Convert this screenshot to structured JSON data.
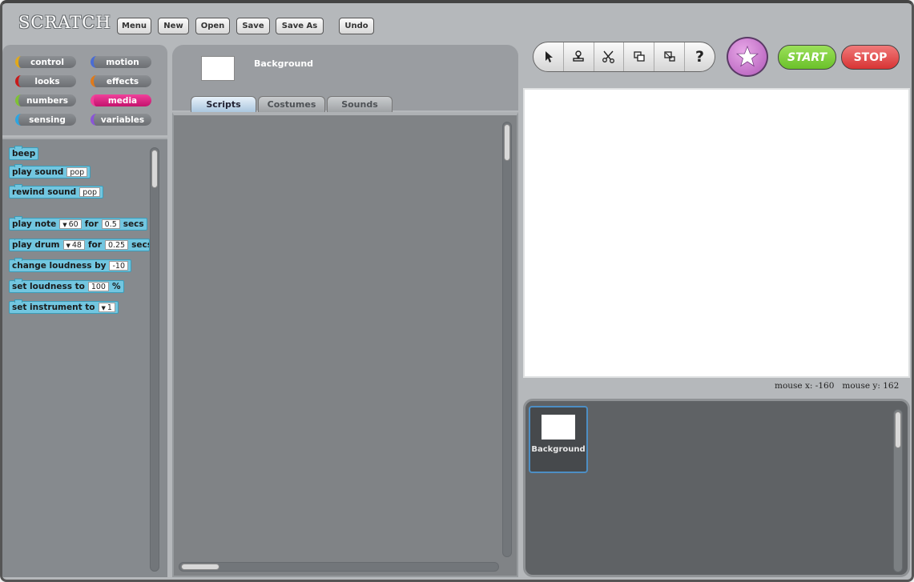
{
  "app": {
    "logo": "SCRATCH"
  },
  "menu": {
    "menu": "Menu",
    "new": "New",
    "open": "Open",
    "save": "Save",
    "save_as": "Save As",
    "undo": "Undo"
  },
  "categories": [
    {
      "label": "control",
      "color": "#e1a91a"
    },
    {
      "label": "motion",
      "color": "#4a6cd4"
    },
    {
      "label": "looks",
      "color": "#c81a1a"
    },
    {
      "label": "effects",
      "color": "#e07a1a"
    },
    {
      "label": "numbers",
      "color": "#7ec234"
    },
    {
      "label": "media",
      "color": "#f0409a",
      "selected": true
    },
    {
      "label": "sensing",
      "color": "#2ca5e2"
    },
    {
      "label": "variables",
      "color": "#8a55d7"
    }
  ],
  "blocks": {
    "beep": "beep",
    "play_sound": {
      "label": "play sound",
      "arg": "pop"
    },
    "rewind_sound": {
      "label": "rewind sound",
      "arg": "pop"
    },
    "play_note": {
      "label": "play note",
      "note": "60",
      "for": "for",
      "secs_val": "0.5",
      "secs": "secs"
    },
    "play_drum": {
      "label": "play drum",
      "drum": "48",
      "for": "for",
      "secs_val": "0.25",
      "secs": "secs"
    },
    "change_loudness": {
      "label": "change loudness by",
      "arg": "-10"
    },
    "set_loudness": {
      "label": "set loudness to",
      "arg": "100",
      "unit": "%"
    },
    "set_instrument": {
      "label": "set instrument to",
      "arg": "1"
    }
  },
  "sprite": {
    "name": "Background"
  },
  "tabs": {
    "scripts": "Scripts",
    "costumes": "Costumes",
    "sounds": "Sounds"
  },
  "tools": {
    "help": "?"
  },
  "controls": {
    "start": "START",
    "stop": "STOP",
    "start_color": "#6bc12a",
    "stop_color": "#d83434"
  },
  "stage": {
    "mouse_x_label": "mouse x:",
    "mouse_x": "-160",
    "mouse_y_label": "mouse y:",
    "mouse_y": "162"
  },
  "sprite_list": {
    "background_label": "Background"
  }
}
